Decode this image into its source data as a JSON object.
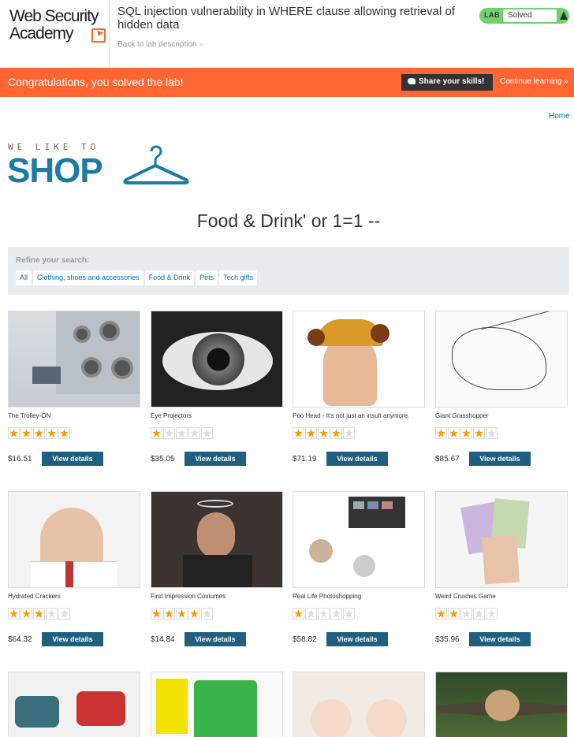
{
  "header": {
    "logo_line1": "Web Security",
    "logo_line2": "Academy",
    "lab_title": "SQL injection vulnerability in WHERE clause allowing retrieval of hidden data",
    "back_link": "Back to lab description",
    "status_prefix": "LAB",
    "status_value": "Solved"
  },
  "banner": {
    "message": "Congratulations, you solved the lab!",
    "share_label": "Share your skills!",
    "continue_label": "Continue learning"
  },
  "nav": {
    "home": "Home"
  },
  "shop": {
    "tagline": "WE LIKE TO",
    "word": "SHOP"
  },
  "category_title": "Food & Drink' or 1=1 --",
  "filter": {
    "label": "Refine your search:",
    "options": [
      "All",
      "Clothing, shoes and accessories",
      "Food & Drink",
      "Pets",
      "Tech gifts"
    ]
  },
  "products": [
    {
      "name": "The Trolley-ON",
      "rating": 5,
      "price": "$16.51",
      "button": "View details"
    },
    {
      "name": "Eye Projectors",
      "rating": 1,
      "price": "$35.05",
      "button": "View details"
    },
    {
      "name": "Poo Head - It's not just an insult anymore.",
      "rating": 4,
      "price": "$71.19",
      "button": "View details"
    },
    {
      "name": "Giant Grasshopper",
      "rating": 4,
      "price": "$85.67",
      "button": "View details"
    },
    {
      "name": "Hydrated Crackers",
      "rating": 3,
      "price": "$64.32",
      "button": "View details"
    },
    {
      "name": "First Impression Costumes",
      "rating": 4,
      "price": "$14.84",
      "button": "View details"
    },
    {
      "name": "Real Life Photoshopping",
      "rating": 1,
      "price": "$58.82",
      "button": "View details"
    },
    {
      "name": "Weird Crushes Game",
      "rating": 2,
      "price": "$35.96",
      "button": "View details"
    },
    {
      "name": "",
      "rating": 0,
      "price": "",
      "button": ""
    },
    {
      "name": "",
      "rating": 0,
      "price": "",
      "button": ""
    },
    {
      "name": "",
      "rating": 0,
      "price": "",
      "button": ""
    },
    {
      "name": "",
      "rating": 0,
      "price": "",
      "button": ""
    }
  ],
  "colors": {
    "banner": "#ff6633",
    "status": "#70d16d",
    "button": "#1f5f80",
    "link": "#0071bc",
    "star": "#ff9900"
  }
}
